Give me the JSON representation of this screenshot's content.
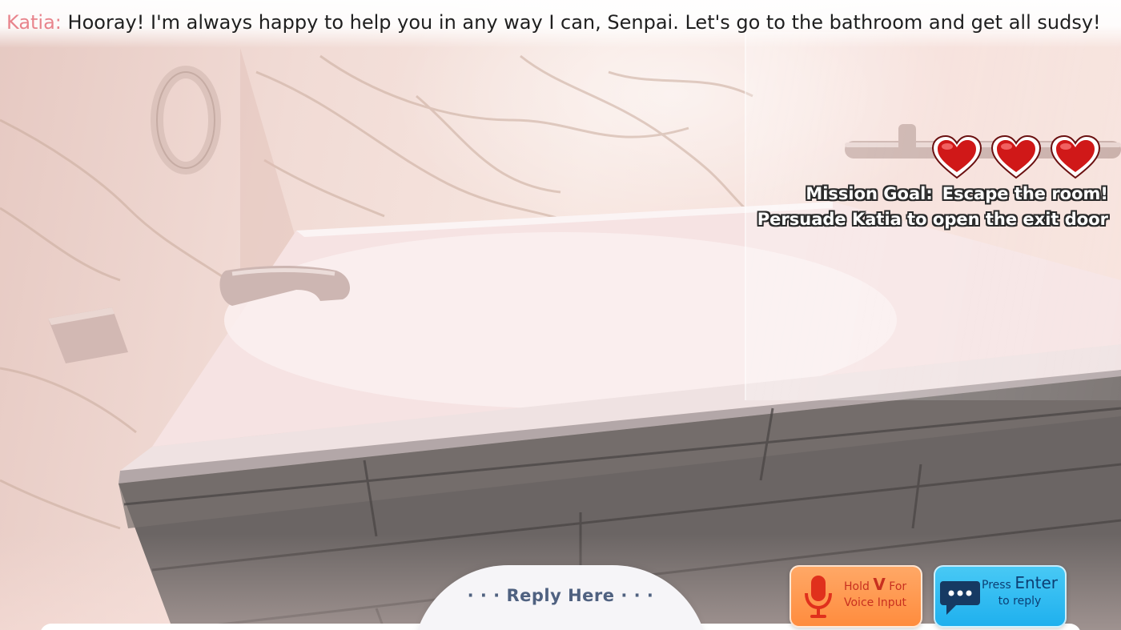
{
  "dialogue": {
    "speaker": "Katia:",
    "text": "Hooray! I'm always happy to help you in any way I can, Senpai. Let's go to the bathroom and get all sudsy!"
  },
  "hud": {
    "lives": 3,
    "mission_label": "Mission Goal:",
    "mission_goal": "Escape the room!",
    "mission_detail": "Persuade Katia to open the exit door"
  },
  "reply": {
    "label": "· · · Reply Here · · ·"
  },
  "buttons": {
    "voice": {
      "prefix": "Hold",
      "key": "V",
      "suffix": "For",
      "line2": "Voice Input",
      "icon": "microphone-icon"
    },
    "enter": {
      "prefix": "Press",
      "key": "Enter",
      "line2": "to reply",
      "icon": "chat-bubble-icon"
    }
  },
  "colors": {
    "speaker": "#e8848c",
    "heart": "#d01818",
    "voice_button": "#ff9a50",
    "enter_button": "#2fbcf2",
    "reply_label": "#4f6180"
  }
}
